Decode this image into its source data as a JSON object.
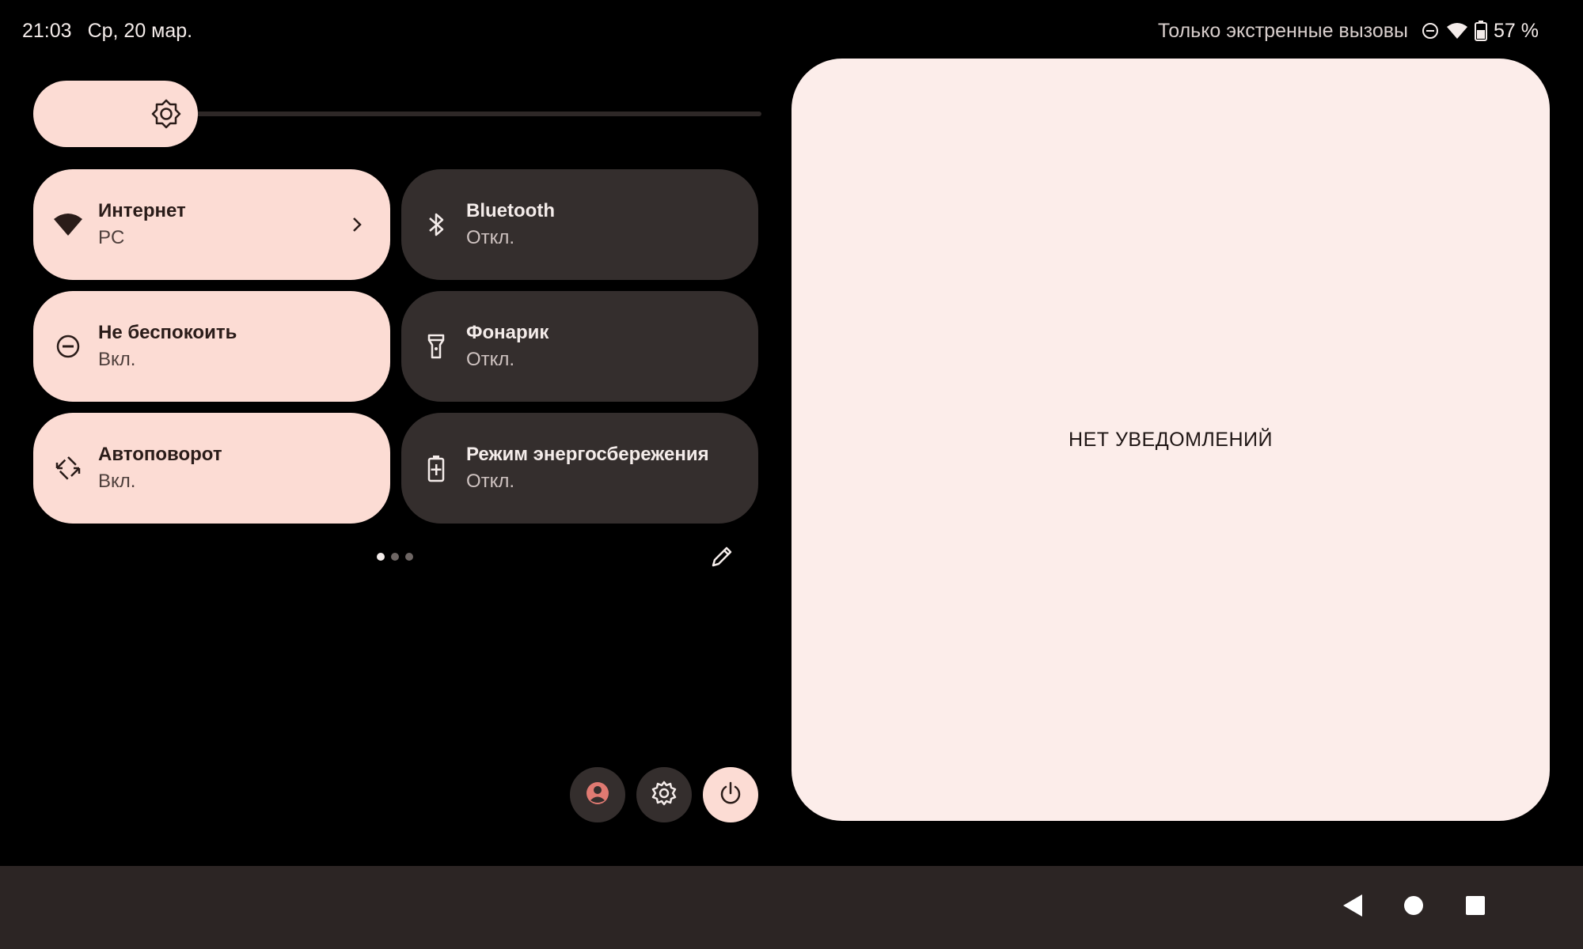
{
  "status_bar": {
    "time": "21:03",
    "date": "Ср, 20 мар.",
    "emergency_text": "Только экстренные вызовы",
    "battery_percent": "57 %",
    "icons": [
      "dnd-icon",
      "wifi-icon",
      "battery-icon"
    ]
  },
  "brightness": {
    "icon": "brightness-icon",
    "level": 0.07
  },
  "tiles": [
    {
      "label": "Интернет",
      "sub": "PC",
      "state": "on",
      "icon": "wifi-icon",
      "has_chevron": true
    },
    {
      "label": "Bluetooth",
      "sub": "Откл.",
      "state": "off",
      "icon": "bluetooth-icon"
    },
    {
      "label": "Не беспокоить",
      "sub": "Вкл.",
      "state": "on",
      "icon": "dnd-icon"
    },
    {
      "label": "Фонарик",
      "sub": "Откл.",
      "state": "off",
      "icon": "flashlight-icon"
    },
    {
      "label": "Автоповорот",
      "sub": "Вкл.",
      "state": "on",
      "icon": "auto-rotate-icon"
    },
    {
      "label": "Режим энергосбережения",
      "sub": "Откл.",
      "state": "off",
      "icon": "battery-saver-icon"
    }
  ],
  "pager": {
    "pages": 3,
    "current": 1
  },
  "footer": {
    "buttons": [
      "user-icon",
      "settings-icon",
      "power-icon"
    ]
  },
  "notifications": {
    "empty_text": "НЕТ УВЕДОМЛЕНИЙ"
  },
  "navbar": {
    "buttons": [
      "back-icon",
      "home-icon",
      "recents-icon"
    ]
  },
  "colors": {
    "accent": "#fcdcd4",
    "tile_off": "#342e2d",
    "panel": "#fcedea",
    "navbar": "#2c2524"
  }
}
